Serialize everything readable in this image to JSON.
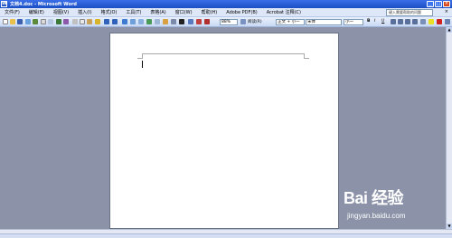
{
  "window": {
    "title": "文档4.doc - Microsoft Word",
    "buttons": [
      "_",
      "□",
      "×"
    ]
  },
  "menubar": {
    "items": [
      "文件(F)",
      "编辑(E)",
      "视图(V)",
      "插入(I)",
      "格式(O)",
      "工具(T)",
      "表格(A)",
      "窗口(W)",
      "帮助(H)",
      "Adobe PDF(B)",
      "Acrobat 注释(C)"
    ],
    "help_placeholder": "键入需要帮助的问题",
    "close_doc": "×"
  },
  "toolbar": {
    "zoom": "88%",
    "read_label": "阅读(R)",
    "style_value": "正文 + 小一",
    "font_value": "宋体",
    "size_value": "小一",
    "bold": "B",
    "italic": "I",
    "underline": "U"
  },
  "watermark": {
    "brand": "Bai 经验",
    "url": "jingyan.baidu.com"
  }
}
